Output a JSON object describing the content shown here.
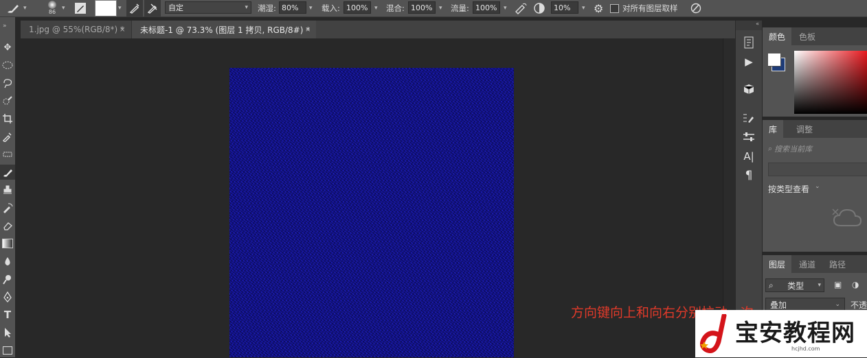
{
  "options_bar": {
    "brush_size": "86",
    "preset_value": "自定",
    "opacity_label": "潮湿:",
    "opacity_value": "80%",
    "load_label": "载入:",
    "load_value": "100%",
    "mix_label": "混合:",
    "mix_value": "100%",
    "flow_label": "流量:",
    "flow_value": "100%",
    "angle_value": "10%",
    "sample_all_label": "对所有图层取样"
  },
  "tabs": [
    {
      "label": "1.jpg @ 55%(RGB/8*) *",
      "close": "×"
    },
    {
      "label": "未标题-1 @ 73.3% (图层 1 拷贝, RGB/8#) *",
      "close": "×"
    }
  ],
  "panels": {
    "color": {
      "tabs": [
        "颜色",
        "色板"
      ]
    },
    "library": {
      "tabs": [
        "库",
        "调整"
      ],
      "search_placeholder": "搜索当前库",
      "view_by": "按类型查看"
    },
    "layers": {
      "tabs": [
        "图层",
        "通道",
        "路径"
      ],
      "filter": "类型",
      "blend_mode": "叠加",
      "opacity_label": "不透"
    }
  },
  "overlay_instruction": "方向键向上和向右分别拉动一次",
  "watermark": {
    "text": "宝安教程网",
    "url": "hcjhd.com"
  },
  "colors": {
    "canvas": "#1b1bb4",
    "foreground": "#ffffff",
    "background": "#1e3c78",
    "overlay_text": "#e23a2a"
  }
}
